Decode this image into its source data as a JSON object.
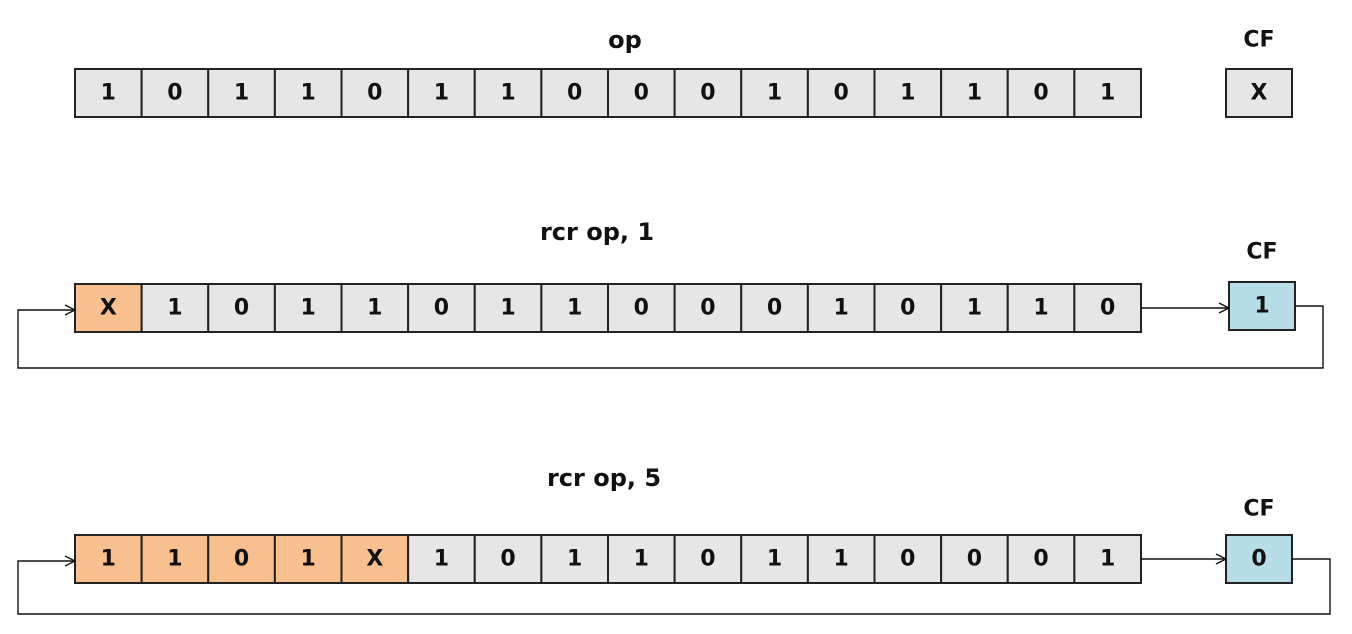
{
  "colors": {
    "default": "#E7E6E6",
    "rotated": "#F9C08F",
    "carry": "#B7DEE8",
    "stroke": "#222222"
  },
  "rows": [
    {
      "title": "op",
      "cf_label": "CF",
      "bits": [
        "1",
        "0",
        "1",
        "1",
        "0",
        "1",
        "1",
        "0",
        "0",
        "0",
        "1",
        "0",
        "1",
        "1",
        "0",
        "1"
      ],
      "rotated_count": 0,
      "cf_value": "X",
      "cf_highlight": false,
      "loop": false
    },
    {
      "title": "rcr  op,  1",
      "cf_label": "CF",
      "bits": [
        "X",
        "1",
        "0",
        "1",
        "1",
        "0",
        "1",
        "1",
        "0",
        "0",
        "0",
        "1",
        "0",
        "1",
        "1",
        "0"
      ],
      "rotated_count": 1,
      "cf_value": "1",
      "cf_highlight": true,
      "loop": true
    },
    {
      "title": "rcr  op,  5",
      "cf_label": "CF",
      "bits": [
        "1",
        "1",
        "0",
        "1",
        "X",
        "1",
        "0",
        "1",
        "1",
        "0",
        "1",
        "1",
        "0",
        "0",
        "0",
        "1"
      ],
      "rotated_count": 5,
      "cf_value": "0",
      "cf_highlight": true,
      "loop": true
    }
  ]
}
